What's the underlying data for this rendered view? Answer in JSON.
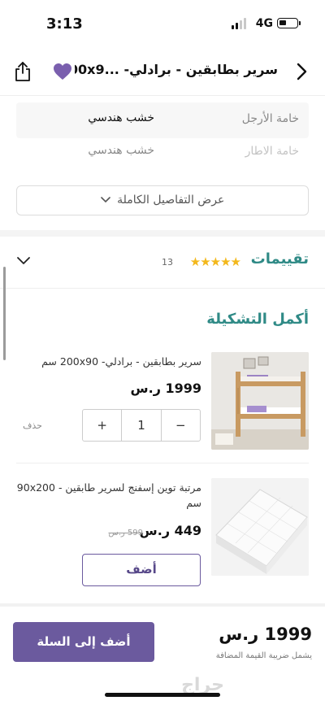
{
  "status_bar": {
    "time": "3:13",
    "network": "4G"
  },
  "header": {
    "title": "سرير بطابقين - برادلي- ...200x9"
  },
  "specs": [
    {
      "key": "خامة الأرجل",
      "value": "خشب هندسي"
    },
    {
      "key": "خامة الاطار",
      "value": "خشب هندسي"
    }
  ],
  "full_details_label": "عرض التفاصيل الكاملة",
  "ratings": {
    "label": "تقييمات",
    "stars": "★★★★★",
    "count": "13"
  },
  "complete_set": {
    "title": "أكمل التشكيلة",
    "products": [
      {
        "name": "سرير بطابقين - برادلي- 200x90 سم",
        "price": "1999 ر.س",
        "quantity": "1",
        "minus": "−",
        "plus": "+",
        "delete": "حذف"
      },
      {
        "name": "مرتبة توين إسفنج لسرير طابقين - 90x200 سم",
        "price": "449 ر.س",
        "old_price": "599 ر.س",
        "add": "أضف"
      }
    ]
  },
  "bottom_bar": {
    "total": "1999 ر.س",
    "vat_note": "يشمل ضريبة القيمة المضافة",
    "add_to_cart": "أضف إلى السلة",
    "watermark": "حراج"
  },
  "colors": {
    "accent": "#6b5a9e",
    "teal": "#2f8a86",
    "star": "#f3b81c"
  },
  "icons": [
    "back-arrow-icon",
    "heart-icon",
    "share-icon",
    "chevron-down-icon",
    "star-icon"
  ]
}
